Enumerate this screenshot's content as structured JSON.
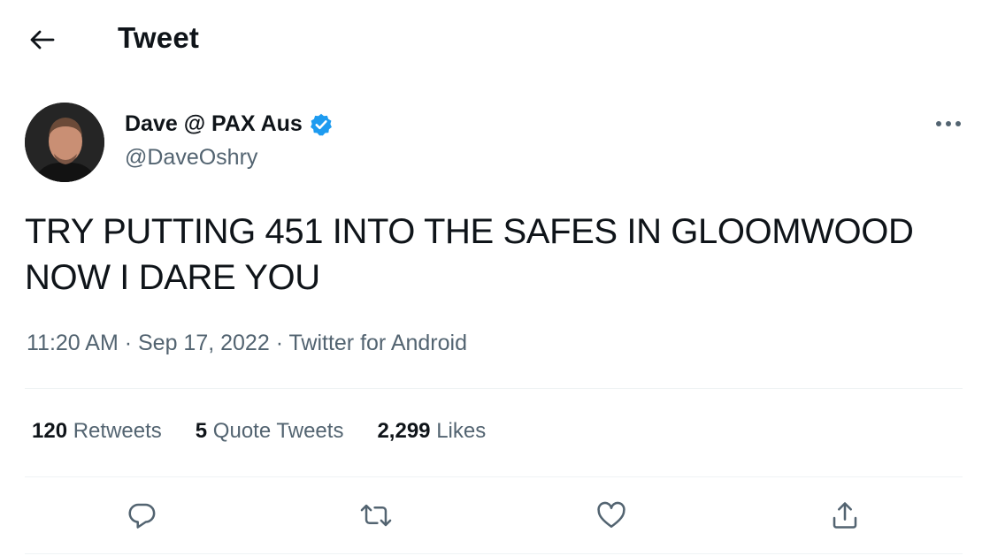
{
  "header": {
    "title": "Tweet",
    "back_icon": "arrow-left-icon"
  },
  "author": {
    "display_name": "Dave @ PAX Aus",
    "handle": "@DaveOshry",
    "verified": true,
    "verified_color": "#1d9bf0"
  },
  "tweet": {
    "text": "TRY PUTTING 451 INTO THE SAFES IN GLOOMWOOD NOW I DARE YOU",
    "time": "11:20 AM",
    "date": "Sep 17, 2022",
    "source": "Twitter for Android",
    "separator": " · "
  },
  "stats": {
    "retweets_count": "120",
    "retweets_label": "Retweets",
    "quotes_count": "5",
    "quotes_label": "Quote Tweets",
    "likes_count": "2,299",
    "likes_label": "Likes"
  },
  "actions": [
    "reply-icon",
    "retweet-icon",
    "like-icon",
    "share-icon"
  ],
  "colors": {
    "text": "#0f1419",
    "secondary": "#536471",
    "divider": "#eff3f4",
    "accent": "#1d9bf0"
  }
}
